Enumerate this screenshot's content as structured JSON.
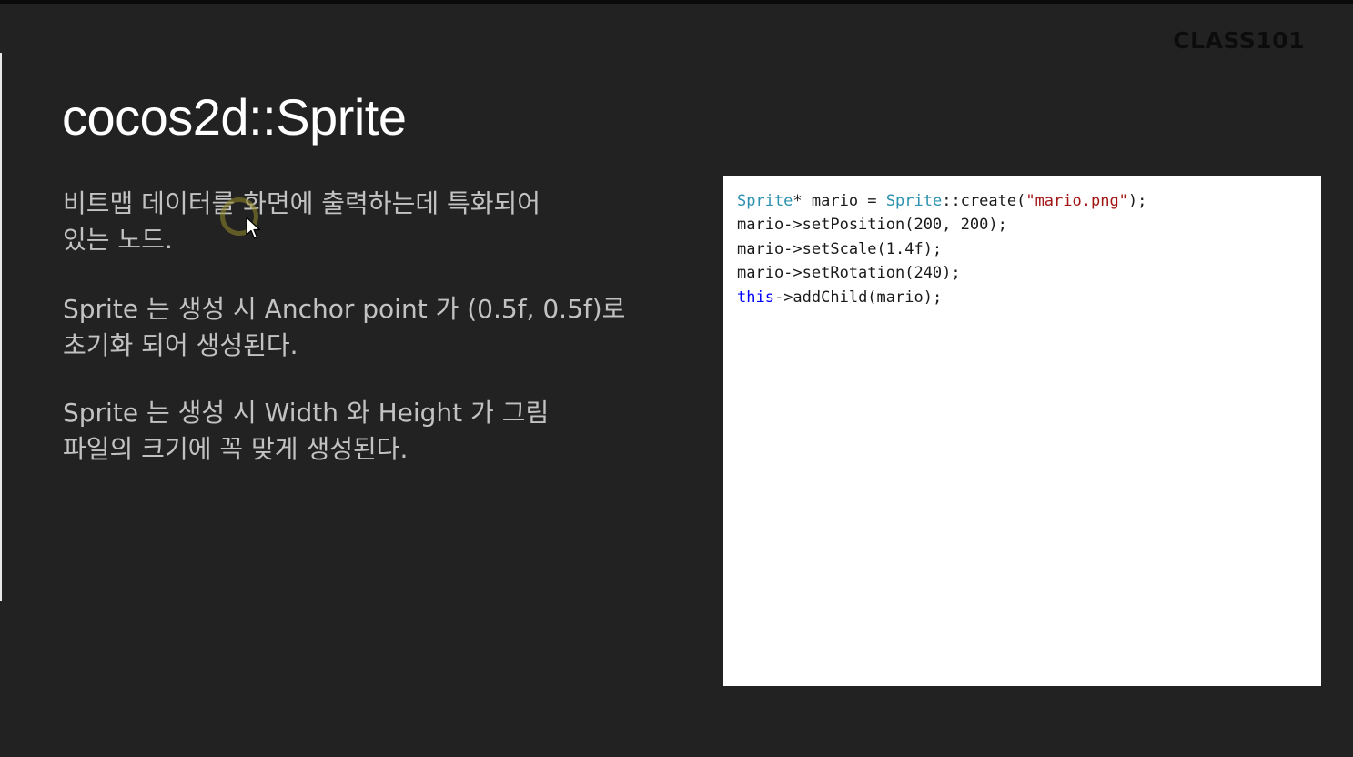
{
  "logo": "CLASS101",
  "title": "cocos2d::Sprite",
  "paragraphs": [
    "비트맵 데이터를 화면에 출력하는데 특화되어\n있는 노드.",
    "Sprite 는 생성 시 Anchor point 가 (0.5f, 0.5f)로\n초기화 되어 생성된다.",
    "Sprite 는 생성 시 Width 와 Height 가 그림\n파일의 크기에 꼭 맞게 생성된다."
  ],
  "code": {
    "line1": {
      "type1": "Sprite",
      "part1": "* mario = ",
      "type2": "Sprite",
      "part2": "::create(",
      "string": "\"mario.png\"",
      "part3": ");"
    },
    "line2": "mario->setPosition(200, 200);",
    "line3": "mario->setScale(1.4f);",
    "line4": "mario->setRotation(240);",
    "line5": {
      "keyword": "this",
      "rest": "->addChild(mario);"
    }
  },
  "colors": {
    "background": "#222222",
    "title": "#ffffff",
    "body_text": "#c2c2c2",
    "code_type": "#2b91af",
    "code_string": "#a31515",
    "code_keyword": "#0000ff"
  },
  "icons": {
    "cursor": "mouse-pointer-icon"
  }
}
